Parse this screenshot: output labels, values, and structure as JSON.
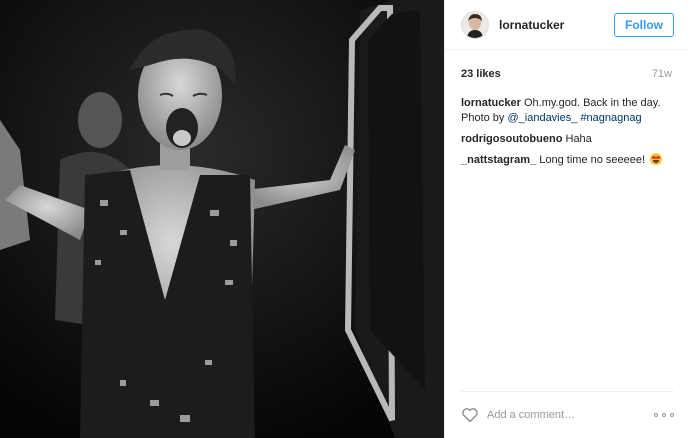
{
  "header": {
    "username": "lornatucker",
    "follow_label": "Follow"
  },
  "meta": {
    "likes": "23 likes",
    "age": "71w"
  },
  "caption": {
    "username": "lornatucker",
    "text_before": " Oh.my.god. Back in the day. Photo by ",
    "mention": "@_iandavies_",
    "space": " ",
    "hashtag": "#nagnagnag"
  },
  "comments": [
    {
      "username": "rodrigosoutobueno",
      "text": " Haha"
    },
    {
      "username": "_nattstagram_",
      "text": " Long time no seeeee! "
    }
  ],
  "footer": {
    "comment_placeholder": "Add a comment…"
  },
  "colors": {
    "accent": "#3897f0",
    "link": "#003569",
    "muted": "#999999"
  },
  "icons": {
    "like": "heart-outline-icon",
    "options": "more-options-icon",
    "emoji": "heart-eyes-emoji"
  }
}
